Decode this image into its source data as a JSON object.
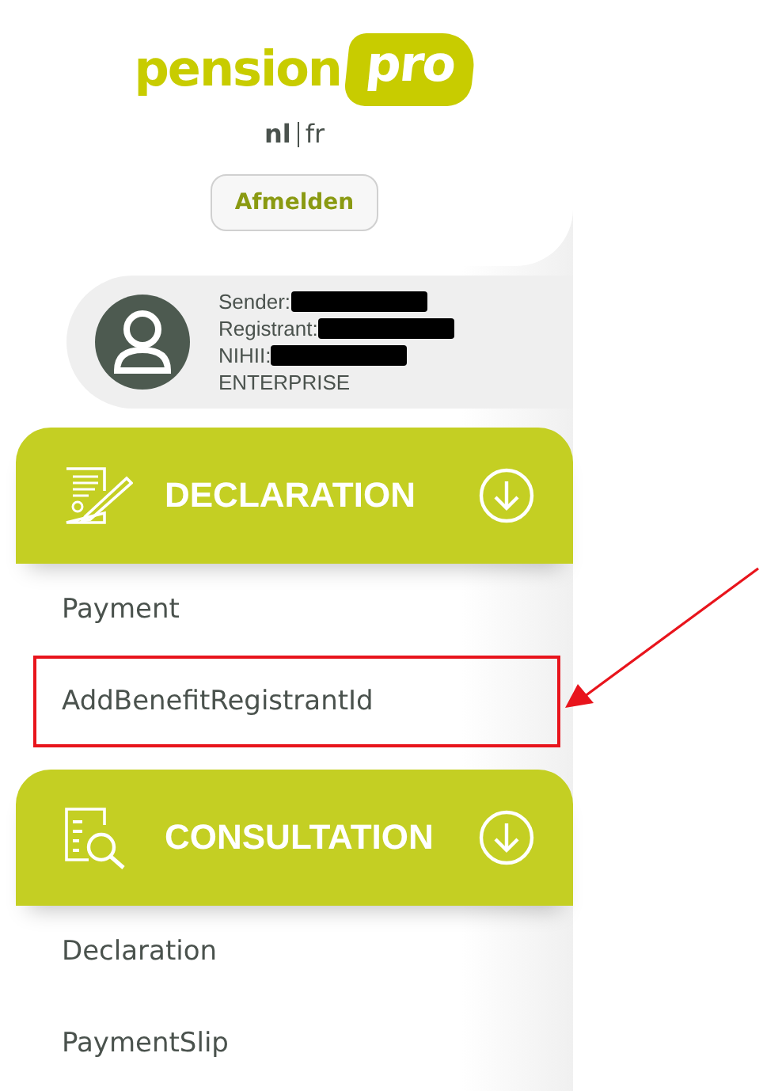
{
  "logo": {
    "word": "pension",
    "badge": "pro"
  },
  "languages": [
    {
      "label": "nl",
      "selected": true
    },
    {
      "label": "fr",
      "selected": false
    }
  ],
  "logout_button": "Afmelden",
  "profile": {
    "fields": [
      {
        "label": "Sender:",
        "redacted": true
      },
      {
        "label": "Registrant:",
        "redacted": true
      },
      {
        "label": "NIHII:",
        "redacted": true
      },
      {
        "label": "ENTERPRISE",
        "redacted": false
      }
    ]
  },
  "sections": [
    {
      "kind": "declaration",
      "title": "DECLARATION",
      "items": [
        {
          "label": "Payment",
          "highlighted": false
        },
        {
          "label": "AddBenefitRegistrantId",
          "highlighted": true
        }
      ]
    },
    {
      "kind": "consultation",
      "title": "CONSULTATION",
      "items": [
        {
          "label": "Declaration",
          "highlighted": false
        },
        {
          "label": "PaymentSlip",
          "highlighted": false
        }
      ]
    }
  ]
}
